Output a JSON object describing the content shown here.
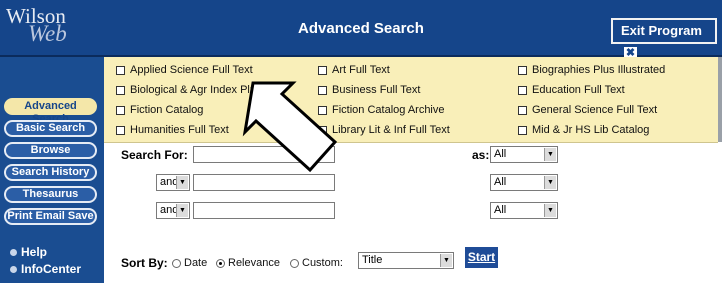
{
  "header": {
    "logo_line1": "Wilson",
    "logo_line2": "Web",
    "title": "Advanced Search",
    "exit_label": "Exit Program",
    "exit_glyph": "✖"
  },
  "sidebar": {
    "buttons": [
      "Advanced Search",
      "Basic Search",
      "Browse",
      "Search History",
      "Thesaurus",
      "Print Email Save"
    ],
    "links": [
      "Help",
      "InfoCenter"
    ]
  },
  "databases": {
    "col1": [
      "Applied Science Full Text",
      "Biological & Agr Index Plus",
      "Fiction Catalog",
      "Humanities Full Text"
    ],
    "col2": [
      "Art Full Text",
      "Business Full Text",
      "Fiction Catalog Archive",
      "Library Lit & Inf Full Text"
    ],
    "col3": [
      "Biographies Plus Illustrated",
      "Education Full Text",
      "General Science Full Text",
      "Mid & Jr HS Lib Catalog"
    ]
  },
  "search": {
    "search_for_label": "Search For:",
    "as_label": "as:",
    "rows": [
      {
        "operator": "",
        "value": "",
        "as": "All"
      },
      {
        "operator": "and",
        "value": "",
        "as": "All"
      },
      {
        "operator": "and",
        "value": "",
        "as": "All"
      }
    ]
  },
  "sort": {
    "label": "Sort By:",
    "options": [
      "Date",
      "Relevance",
      "Custom:"
    ],
    "selected": "Relevance",
    "custom_value": "Title"
  },
  "start_label": "Start",
  "colors": {
    "header_bg": "#15458a",
    "panel_bg": "#f9efb9",
    "active_button": "#f4e7a9"
  }
}
